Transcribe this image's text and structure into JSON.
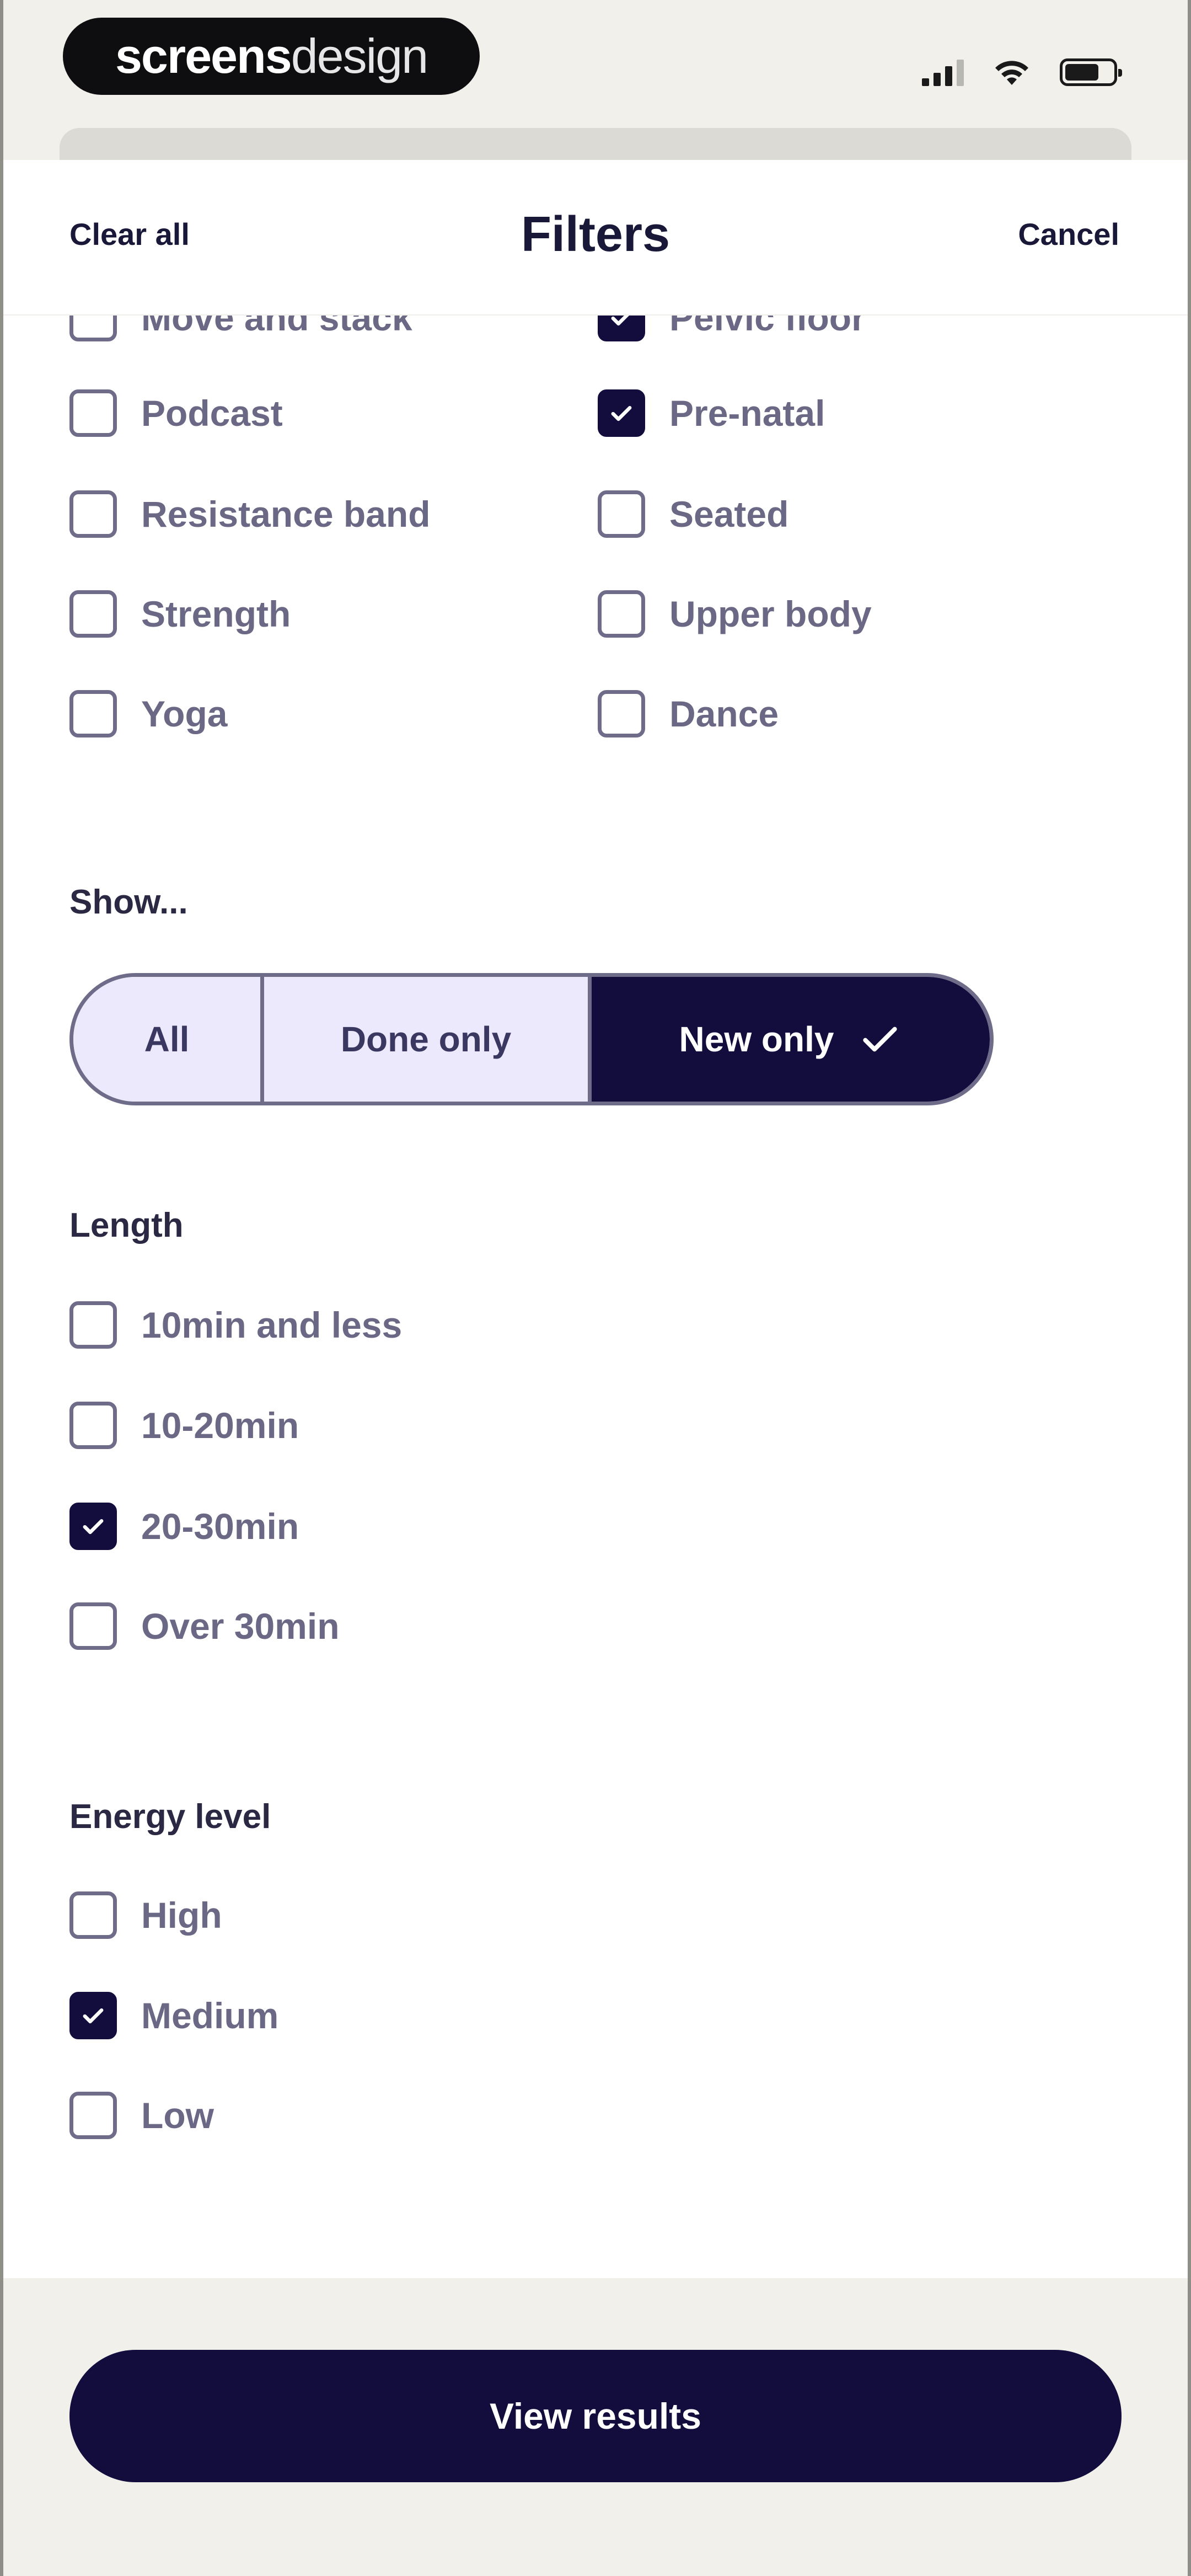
{
  "brand": {
    "part1": "screens",
    "part2": "design"
  },
  "status_icons": [
    "signal-icon",
    "wifi-icon",
    "battery-icon"
  ],
  "nav": {
    "clear_label": "Clear all",
    "title": "Filters",
    "cancel_label": "Cancel"
  },
  "type_filters": {
    "left": [
      {
        "label": "Move and stack",
        "checked": false
      },
      {
        "label": "Podcast",
        "checked": false
      },
      {
        "label": "Resistance band",
        "checked": false
      },
      {
        "label": "Strength",
        "checked": false
      },
      {
        "label": "Yoga",
        "checked": false
      }
    ],
    "right": [
      {
        "label": "Pelvic floor",
        "checked": true
      },
      {
        "label": "Pre-natal",
        "checked": true
      },
      {
        "label": "Seated",
        "checked": false
      },
      {
        "label": "Upper body",
        "checked": false
      },
      {
        "label": "Dance",
        "checked": false
      }
    ]
  },
  "show": {
    "title": "Show...",
    "options": [
      "All",
      "Done only",
      "New only"
    ],
    "selected": "New only"
  },
  "length": {
    "title": "Length",
    "options": [
      {
        "label": "10min and less",
        "checked": false
      },
      {
        "label": "10-20min",
        "checked": false
      },
      {
        "label": "20-30min",
        "checked": true
      },
      {
        "label": "Over 30min",
        "checked": false
      }
    ]
  },
  "energy": {
    "title": "Energy level",
    "options": [
      {
        "label": "High",
        "checked": false
      },
      {
        "label": "Medium",
        "checked": true
      },
      {
        "label": "Low",
        "checked": false
      }
    ]
  },
  "cta": {
    "label": "View results"
  },
  "colors": {
    "primary": "#120d3d",
    "segment_bg": "#ebe9fb",
    "label": "#6a6884",
    "bar_bg": "#f2f0ea"
  }
}
